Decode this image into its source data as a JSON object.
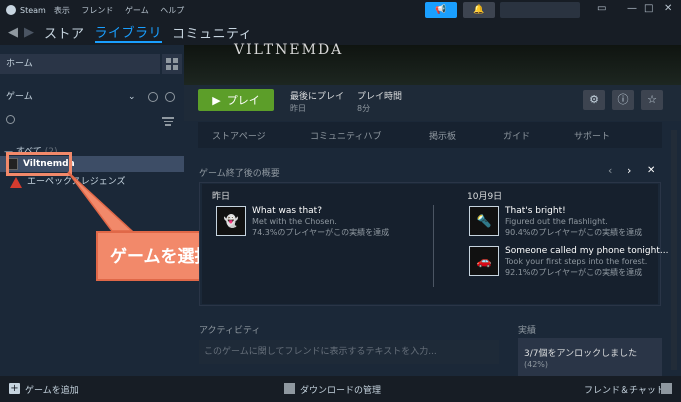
{
  "titlebar": {
    "app": "Steam",
    "menu": [
      "表示",
      "フレンド",
      "ゲーム",
      "ヘルプ"
    ]
  },
  "nav": {
    "store": "ストア",
    "library": "ライブラリ",
    "community": "コミュニティ"
  },
  "sidebar": {
    "home": "ホーム",
    "filter": "ゲーム",
    "all_label": "— すべて",
    "all_count": "(2)",
    "games": [
      "Viltnemda",
      "エーペックスレジェンズ"
    ]
  },
  "callout": {
    "text": "ゲームを選択"
  },
  "hero": {
    "title": "VILTNEMDA"
  },
  "actions": {
    "play": "プレイ",
    "last_played_label": "最後にプレイ",
    "last_played_value": "昨日",
    "playtime_label": "プレイ時間",
    "playtime_value": "8分"
  },
  "tabs": [
    "ストアページ",
    "コミュニティハブ",
    "掲示板",
    "ガイド",
    "サポート"
  ],
  "summary": {
    "title": "ゲーム終了後の概要",
    "left_date": "昨日",
    "right_date": "10月9日",
    "achievements": [
      {
        "title": "What was that?",
        "desc": "Met with the Chosen.",
        "pct": "74.3%のプレイヤーがこの実績を達成"
      },
      {
        "title": "That's bright!",
        "desc": "Figured out the flashlight.",
        "pct": "90.4%のプレイヤーがこの実績を達成"
      },
      {
        "title": "Someone called my phone tonight...",
        "desc": "Took your first steps into the forest.",
        "pct": "92.1%のプレイヤーがこの実績を達成"
      }
    ]
  },
  "activity": {
    "title": "アクティビティ",
    "placeholder": "このゲームに関してフレンドに表示するテキストを入力..."
  },
  "achievements_panel": {
    "title": "実績",
    "unlocked": "3/7個をアンロックしました",
    "percent": "(42%)"
  },
  "bottombar": {
    "add_game": "ゲームを追加",
    "downloads": "ダウンロードの管理",
    "friends": "フレンド＆チャット"
  }
}
